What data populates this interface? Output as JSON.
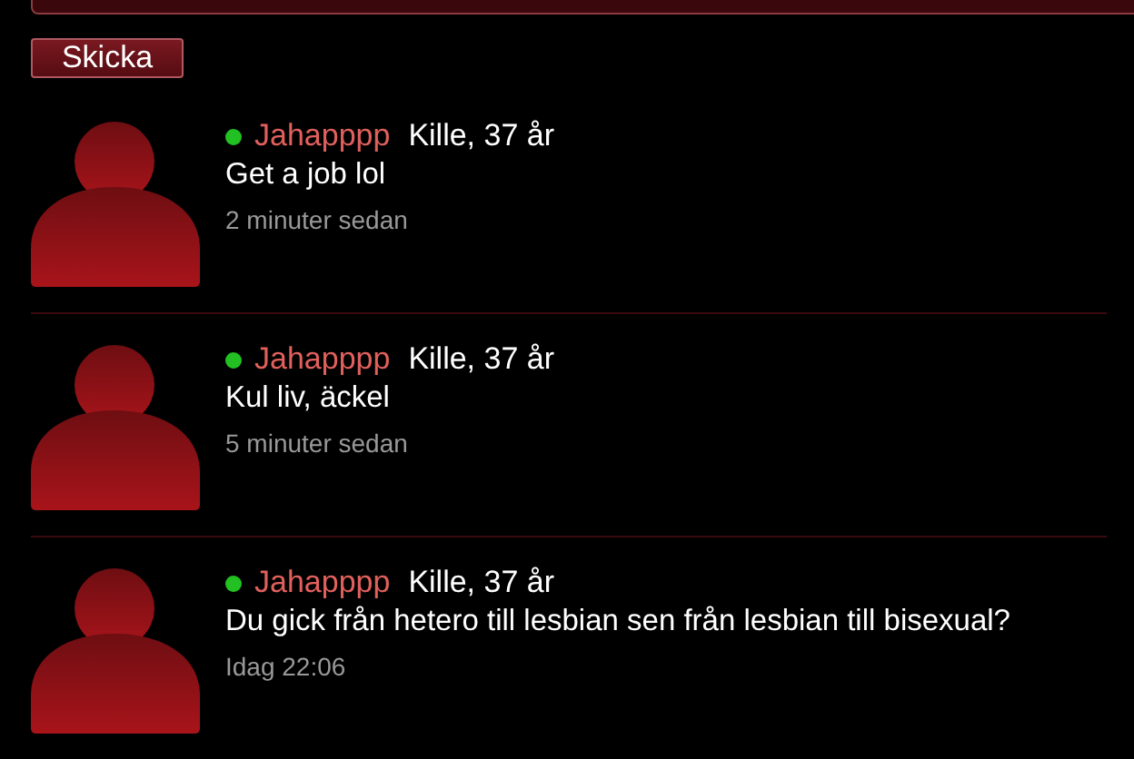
{
  "send_button": {
    "label": "Skicka"
  },
  "posts": [
    {
      "online": true,
      "username": "Jahapppp",
      "info": "Kille, 37 år",
      "message": "Get a job lol",
      "time": "2 minuter sedan"
    },
    {
      "online": true,
      "username": "Jahapppp",
      "info": "Kille, 37 år",
      "message": "Kul liv, äckel",
      "time": "5 minuter sedan"
    },
    {
      "online": true,
      "username": "Jahapppp",
      "info": "Kille, 37 år",
      "message": "Du gick från hetero till lesbian sen från lesbian till bisexual?",
      "time": "Idag 22:06"
    }
  ]
}
